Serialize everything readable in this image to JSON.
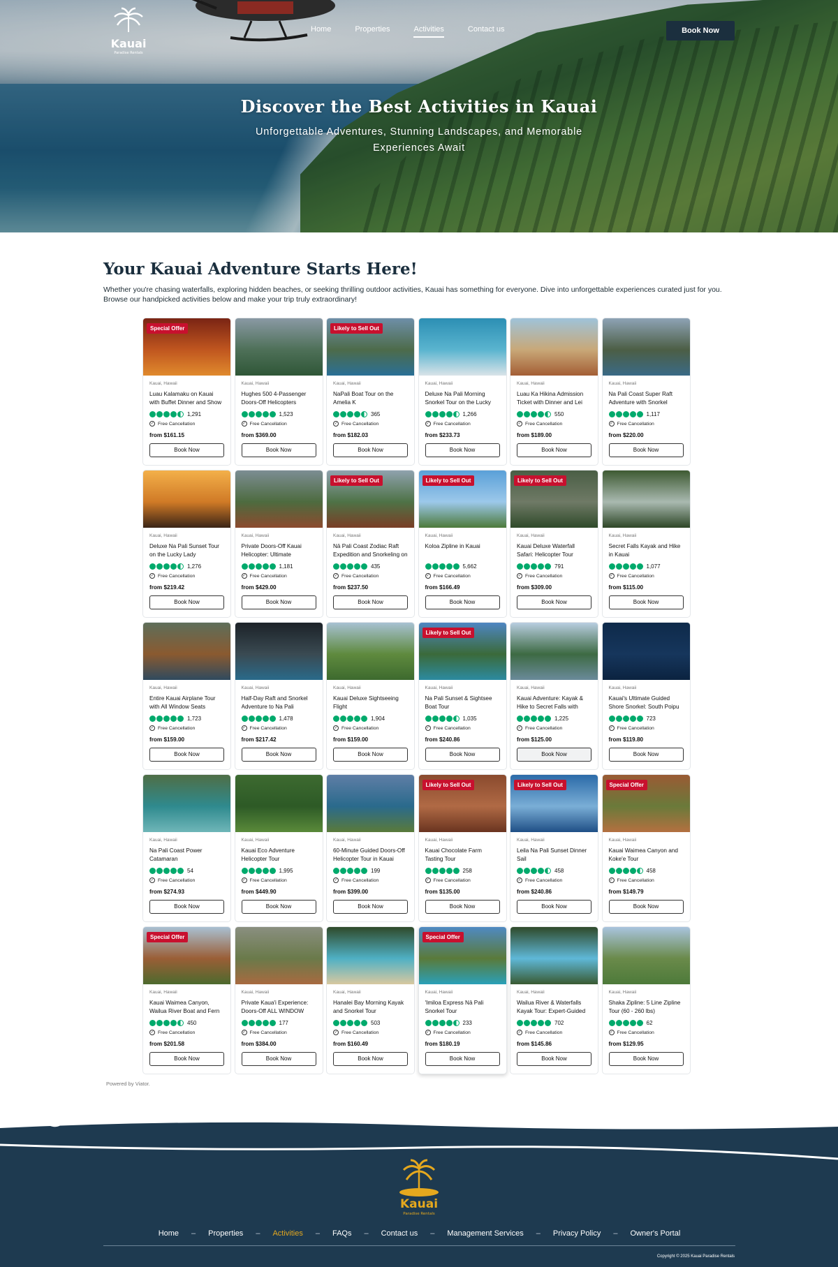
{
  "header": {
    "logo_text": "Kauai",
    "logo_sub": "Paradise Rentals",
    "nav": [
      {
        "label": "Home",
        "active": false
      },
      {
        "label": "Properties",
        "active": false
      },
      {
        "label": "Activities",
        "active": true
      },
      {
        "label": "Contact us",
        "active": false
      }
    ],
    "book_label": "Book Now"
  },
  "hero": {
    "title": "Discover the Best Activities in Kauai",
    "subtitle": "Unforgettable Adventures, Stunning Landscapes, and Memorable Experiences Await"
  },
  "intro": {
    "title": "Your Kauai Adventure Starts Here!",
    "text": "Whether you're chasing waterfalls, exploring hidden beaches, or seeking thrilling outdoor activities, Kauai has something for everyone. Dive into unforgettable experiences curated just for you. Browse our handpicked activities below and make your trip truly extraordinary!"
  },
  "card_labels": {
    "location": "Kauai, Hawaii",
    "cancellation": "Free Cancellation",
    "book": "Book Now"
  },
  "activities": [
    {
      "title": "Luau Kalamaku on Kauai with Buffet Dinner and Show",
      "reviews": "1,291",
      "rating": 4.5,
      "price": "from $161.15",
      "badge": "Special Offer",
      "colors": [
        "#7a2414",
        "#c0561f",
        "#e08a2d"
      ]
    },
    {
      "title": "Hughes 500 4-Passenger Doors-Off Helicopters",
      "reviews": "1,523",
      "rating": 5,
      "price": "from $369.00",
      "badge": "",
      "colors": [
        "#8a99a4",
        "#4e7058",
        "#2f5637"
      ]
    },
    {
      "title": "NaPali Boat Tour on the Amelia K",
      "reviews": "365",
      "rating": 4.5,
      "price": "from $182.03",
      "badge": "Likely to Sell Out",
      "colors": [
        "#6e8fa8",
        "#4d6b4a",
        "#2a6f96"
      ]
    },
    {
      "title": "Deluxe Na Pali Morning Snorkel Tour on the Lucky Lady",
      "reviews": "1,266",
      "rating": 4.5,
      "price": "from $233.73",
      "badge": "",
      "colors": [
        "#2c8fb4",
        "#5ab4cf",
        "#d9e3e8"
      ]
    },
    {
      "title": "Luau Ka Hikina Admission Ticket with Dinner and Lei Greeting",
      "reviews": "550",
      "rating": 4.5,
      "price": "from $189.00",
      "badge": "",
      "colors": [
        "#9fc3d9",
        "#c8a878",
        "#a45e35"
      ]
    },
    {
      "title": "Na Pali Coast Super Raft Adventure with Snorkel",
      "reviews": "1,117",
      "rating": 5,
      "price": "from $220.00",
      "badge": "",
      "colors": [
        "#8ea3b5",
        "#4c5e45",
        "#3a6a86"
      ]
    },
    {
      "title": "Deluxe Na Pali Sunset Tour on the Lucky Lady",
      "reviews": "1,276",
      "rating": 4.5,
      "price": "from $219.42",
      "badge": "",
      "colors": [
        "#f3b04a",
        "#d07a26",
        "#3a2416"
      ]
    },
    {
      "title": "Private Doors-Off Kauai Helicopter: Ultimate Adventure",
      "reviews": "1,181",
      "rating": 5,
      "price": "from $429.00",
      "badge": "",
      "colors": [
        "#7c8d93",
        "#4d6b3f",
        "#8c4a2e"
      ]
    },
    {
      "title": "Nā Pali Coast Zodiac Raft Expedition and Snorkeling on Kauai",
      "reviews": "435",
      "rating": 5,
      "price": "from $237.50",
      "badge": "Likely to Sell Out",
      "colors": [
        "#8fa2ae",
        "#4e7246",
        "#7a3e26"
      ]
    },
    {
      "title": "Koloa Zipline in Kauai",
      "reviews": "5,662",
      "rating": 5,
      "price": "from $166.49",
      "badge": "Likely to Sell Out",
      "colors": [
        "#5aa0d8",
        "#9cc8ea",
        "#4d7a3a"
      ]
    },
    {
      "title": "Kauai Deluxe Waterfall Safari: Helicopter Tour",
      "reviews": "791",
      "rating": 5,
      "price": "from $309.00",
      "badge": "Likely to Sell Out",
      "colors": [
        "#4a5e45",
        "#6f7a66",
        "#2f4a2a"
      ]
    },
    {
      "title": "Secret Falls Kayak and Hike in Kauai",
      "reviews": "1,077",
      "rating": 5,
      "price": "from $115.00",
      "badge": "",
      "colors": [
        "#3e5a32",
        "#a9b9b0",
        "#2d4626"
      ]
    },
    {
      "title": "Entire Kauai Airplane Tour with All Window Seats",
      "reviews": "1,723",
      "rating": 5,
      "price": "from $159.00",
      "badge": "",
      "colors": [
        "#5e6e5a",
        "#8a5a30",
        "#2f4a5e"
      ]
    },
    {
      "title": "Half-Day Raft and Snorkel Adventure to Na Pali",
      "reviews": "1,478",
      "rating": 5,
      "price": "from $217.42",
      "badge": "",
      "colors": [
        "#1c2228",
        "#3a4a52",
        "#2a6a8a"
      ]
    },
    {
      "title": "Kauai Deluxe Sightseeing Flight",
      "reviews": "1,904",
      "rating": 5,
      "price": "from $159.00",
      "badge": "",
      "colors": [
        "#a7c1d2",
        "#5f8a3e",
        "#3d6a2e"
      ]
    },
    {
      "title": "Na Pali Sunset & Sightsee Boat Tour",
      "reviews": "1,035",
      "rating": 4.5,
      "price": "from $240.86",
      "badge": "Likely to Sell Out",
      "colors": [
        "#4e86c2",
        "#3b6a3a",
        "#2c8aa0"
      ]
    },
    {
      "title": "Kauai Adventure: Kayak & Hike to Secret Falls with Lunch",
      "reviews": "1,225",
      "rating": 5,
      "price": "from $125.00",
      "badge": "",
      "colors": [
        "#b8cde0",
        "#3d6a43",
        "#6a8a9a"
      ]
    },
    {
      "title": "Kauai's Ultimate Guided Shore Snorkel: South Poipu",
      "reviews": "723",
      "rating": 5,
      "price": "from $119.80",
      "badge": "",
      "colors": [
        "#0e2a4a",
        "#16365c",
        "#0b2340"
      ]
    },
    {
      "title": "Na Pali Coast Power Catamaran",
      "reviews": "54",
      "rating": 5,
      "price": "from $274.93",
      "badge": "",
      "colors": [
        "#4f6e46",
        "#2f8a8e",
        "#6fb6b8"
      ]
    },
    {
      "title": "Kauai Eco Adventure Helicopter Tour",
      "reviews": "1,995",
      "rating": 5,
      "price": "from $449.90",
      "badge": "",
      "colors": [
        "#3d6a30",
        "#2d5a26",
        "#5a8a3a"
      ]
    },
    {
      "title": "60-Minute Guided Doors-Off Helicopter Tour in Kauai",
      "reviews": "199",
      "rating": 5,
      "price": "from $399.00",
      "badge": "",
      "colors": [
        "#5f7ea6",
        "#2a6a8c",
        "#5a7a3a"
      ]
    },
    {
      "title": "Kauai Chocolate Farm Tasting Tour",
      "reviews": "258",
      "rating": 5,
      "price": "from $135.00",
      "badge": "Likely to Sell Out",
      "colors": [
        "#8a4a2e",
        "#b06a45",
        "#6a3420"
      ]
    },
    {
      "title": "Leila Na Pali Sunset Dinner Sail",
      "reviews": "458",
      "rating": 4.5,
      "price": "from $240.86",
      "badge": "Likely to Sell Out",
      "colors": [
        "#2b6aa8",
        "#7aaed6",
        "#1f4f86"
      ]
    },
    {
      "title": "Kauai Waimea Canyon and Koke'e Tour",
      "reviews": "458",
      "rating": 4.5,
      "price": "from $149.79",
      "badge": "Special Offer",
      "colors": [
        "#9a5a34",
        "#6a7a3a",
        "#b47040"
      ]
    },
    {
      "title": "Kauai Waimea Canyon, Wailua River Boat and Fern Grotto",
      "reviews": "450",
      "rating": 4.5,
      "price": "from $201.58",
      "badge": "Special Offer",
      "colors": [
        "#a9c0d2",
        "#9a5e36",
        "#4d6a2e"
      ]
    },
    {
      "title": "Private Kaua'i Experience: Doors-Off ALL WINDOW SEATS",
      "reviews": "177",
      "rating": 5,
      "price": "from $384.00",
      "badge": "",
      "colors": [
        "#8a8f80",
        "#6a7a4a",
        "#a86a40"
      ]
    },
    {
      "title": "Hanalei Bay Morning Kayak and Snorkel Tour",
      "reviews": "503",
      "rating": 5,
      "price": "from $160.49",
      "badge": "",
      "colors": [
        "#2f4a2a",
        "#4fb0c4",
        "#d8c8a0"
      ]
    },
    {
      "title": "'Imiloa Express Nā Pali Snorkel Tour",
      "reviews": "233",
      "rating": 4.5,
      "price": "from $180.19",
      "badge": "Special Offer",
      "colors": [
        "#4f8ac2",
        "#5a7a3a",
        "#2aa0b8"
      ]
    },
    {
      "title": "Wailua River & Waterfalls Kayak Tour: Expert-Guided Adventure",
      "reviews": "702",
      "rating": 5,
      "price": "from $145.86",
      "badge": "",
      "colors": [
        "#2f4a2a",
        "#5fb8d8",
        "#3a5a32"
      ]
    },
    {
      "title": "Shaka Zipline: 5 Line Zipline Tour (60 - 260 lbs)",
      "reviews": "62",
      "rating": 5,
      "price": "from $129.95",
      "badge": "",
      "colors": [
        "#a9c4de",
        "#6a8a4a",
        "#4d7a3a"
      ]
    }
  ],
  "powered_by": "Powered by Viator.",
  "footer": {
    "logo_text": "Kauai",
    "logo_sub": "Paradise Rentals",
    "nav": [
      {
        "label": "Home",
        "active": false
      },
      {
        "label": "Properties",
        "active": false
      },
      {
        "label": "Activities",
        "active": true
      },
      {
        "label": "FAQs",
        "active": false
      },
      {
        "label": "Contact us",
        "active": false
      },
      {
        "label": "Management Services",
        "active": false
      },
      {
        "label": "Privacy Policy",
        "active": false
      },
      {
        "label": "Owner's Portal",
        "active": false
      }
    ],
    "separator": "–",
    "copyright": "Copyright © 2025 Kauai Paradise Rentals"
  }
}
